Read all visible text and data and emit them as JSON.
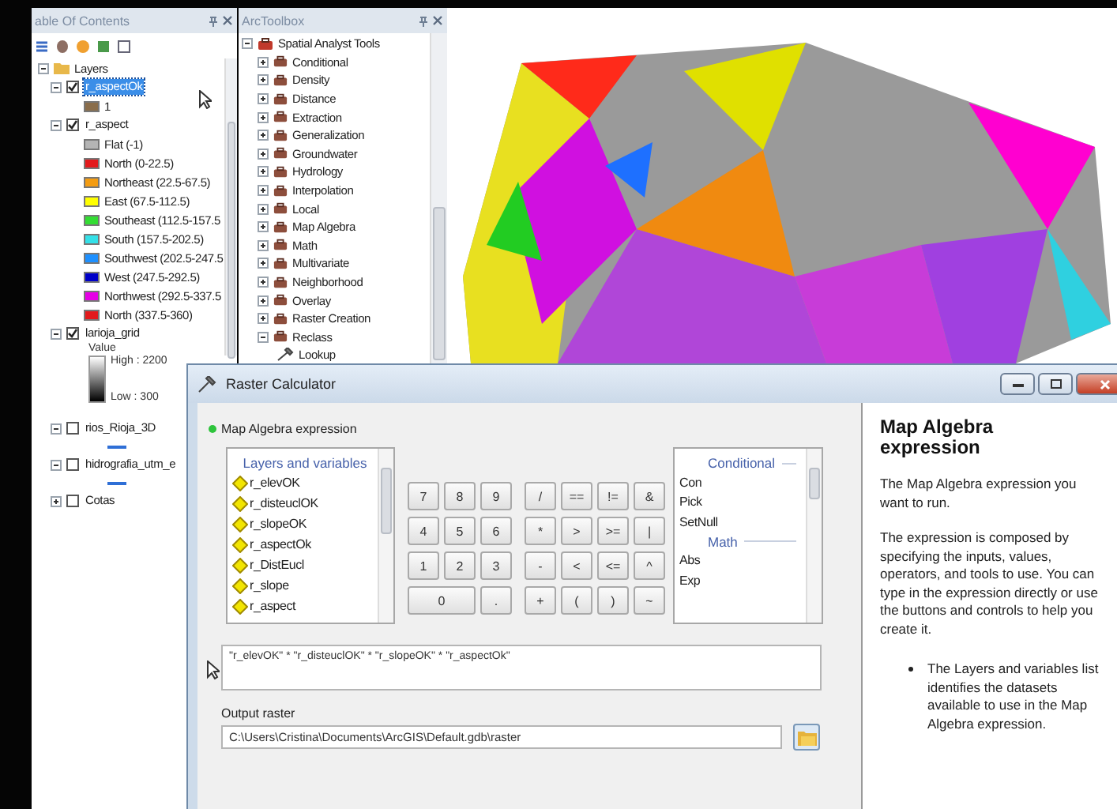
{
  "toc": {
    "title": "able Of Contents",
    "tree": {
      "label": "Layers",
      "expanded": true,
      "children": [
        {
          "kind": "classes",
          "label": "r_aspectOk",
          "checked": true,
          "selected": true,
          "expanded": true,
          "legend": [
            {
              "label": "1",
              "color": "#8a6d4a"
            }
          ]
        },
        {
          "kind": "classes",
          "label": "r_aspect",
          "checked": true,
          "selected": false,
          "expanded": true,
          "legend": [
            {
              "label": "Flat (-1)",
              "color": "#b4b4b4"
            },
            {
              "label": "North (0-22.5)",
              "color": "#e31a1c"
            },
            {
              "label": "Northeast (22.5-67.5)",
              "color": "#f39c12"
            },
            {
              "label": "East (67.5-112.5)",
              "color": "#ffff00"
            },
            {
              "label": "Southeast (112.5-157.5",
              "color": "#33dd33"
            },
            {
              "label": "South (157.5-202.5)",
              "color": "#33e0e8"
            },
            {
              "label": "Southwest (202.5-247.5",
              "color": "#1e90ff"
            },
            {
              "label": "West (247.5-292.5)",
              "color": "#0000c8"
            },
            {
              "label": "Northwest (292.5-337.5",
              "color": "#e600e6"
            },
            {
              "label": "North (337.5-360)",
              "color": "#e31a1c"
            }
          ]
        },
        {
          "kind": "stretched",
          "label": "larioja_grid",
          "checked": true,
          "selected": false,
          "expanded": true,
          "value_label": "Value",
          "high": "High : 2200",
          "low": "Low : 300"
        },
        {
          "kind": "line",
          "label": "rios_Rioja_3D",
          "checked": false,
          "selected": false,
          "expanded": true
        },
        {
          "kind": "line",
          "label": "hidrografia_utm_e",
          "checked": false,
          "selected": false,
          "expanded": true
        },
        {
          "kind": "line",
          "label": "Cotas",
          "checked": false,
          "selected": false,
          "expanded": false
        }
      ]
    }
  },
  "toolbox": {
    "title": "ArcToolbox",
    "tree": {
      "kind": "toolbox",
      "label": "Spatial Analyst Tools",
      "expanded": true,
      "children": [
        {
          "kind": "toolset",
          "label": "Conditional",
          "expanded": false
        },
        {
          "kind": "toolset",
          "label": "Density",
          "expanded": false
        },
        {
          "kind": "toolset",
          "label": "Distance",
          "expanded": false
        },
        {
          "kind": "toolset",
          "label": "Extraction",
          "expanded": false
        },
        {
          "kind": "toolset",
          "label": "Generalization",
          "expanded": false
        },
        {
          "kind": "toolset",
          "label": "Groundwater",
          "expanded": false
        },
        {
          "kind": "toolset",
          "label": "Hydrology",
          "expanded": false
        },
        {
          "kind": "toolset",
          "label": "Interpolation",
          "expanded": false
        },
        {
          "kind": "toolset",
          "label": "Local",
          "expanded": false
        },
        {
          "kind": "toolset",
          "label": "Map Algebra",
          "expanded": false
        },
        {
          "kind": "toolset",
          "label": "Math",
          "expanded": false
        },
        {
          "kind": "toolset",
          "label": "Multivariate",
          "expanded": false
        },
        {
          "kind": "toolset",
          "label": "Neighborhood",
          "expanded": false
        },
        {
          "kind": "toolset",
          "label": "Overlay",
          "expanded": false
        },
        {
          "kind": "toolset",
          "label": "Raster Creation",
          "expanded": false
        },
        {
          "kind": "toolset",
          "label": "Reclass",
          "expanded": true,
          "children": [
            {
              "kind": "tool",
              "label": "Lookup"
            }
          ]
        }
      ]
    }
  },
  "calculator": {
    "title": "Raster Calculator",
    "expression_label": "Map Algebra expression",
    "variables": {
      "header": "Layers and variables",
      "items": [
        "r_elevOK",
        "r_disteuclOK",
        "r_slopeOK",
        "r_aspectOk",
        "r_DistEucl",
        "r_slope",
        "r_aspect"
      ]
    },
    "digits": [
      [
        "7",
        "8",
        "9"
      ],
      [
        "4",
        "5",
        "6"
      ],
      [
        "1",
        "2",
        "3"
      ],
      [
        "0",
        "."
      ]
    ],
    "operators": [
      [
        "/",
        "==",
        "!=",
        "&"
      ],
      [
        "*",
        ">",
        ">=",
        "|"
      ],
      [
        "-",
        "<",
        "<=",
        "^"
      ],
      [
        "+",
        "(",
        ")",
        "~"
      ]
    ],
    "functions": [
      {
        "header": "Conditional",
        "items": [
          "Con",
          "Pick",
          "SetNull"
        ]
      },
      {
        "header": "Math",
        "items": [
          "Abs",
          "Exp"
        ]
      }
    ],
    "expression": "\"r_elevOK\" * \"r_disteuclOK\" * \"r_slopeOK\" * \"r_aspectOk\"",
    "output_label": "Output raster",
    "output_value": "C:\\Users\\Cristina\\Documents\\ArcGIS\\Default.gdb\\raster",
    "help": {
      "title": "Map Algebra expression",
      "paragraphs": [
        "The Map Algebra expression you want to run.",
        "The expression is composed by specifying the inputs, values, operators, and tools to use. You can type in the expression directly or use the buttons and controls to help you create it."
      ],
      "bullets": [
        "The Layers and variables list identifies the datasets available to use in the Map Algebra expression."
      ]
    }
  }
}
